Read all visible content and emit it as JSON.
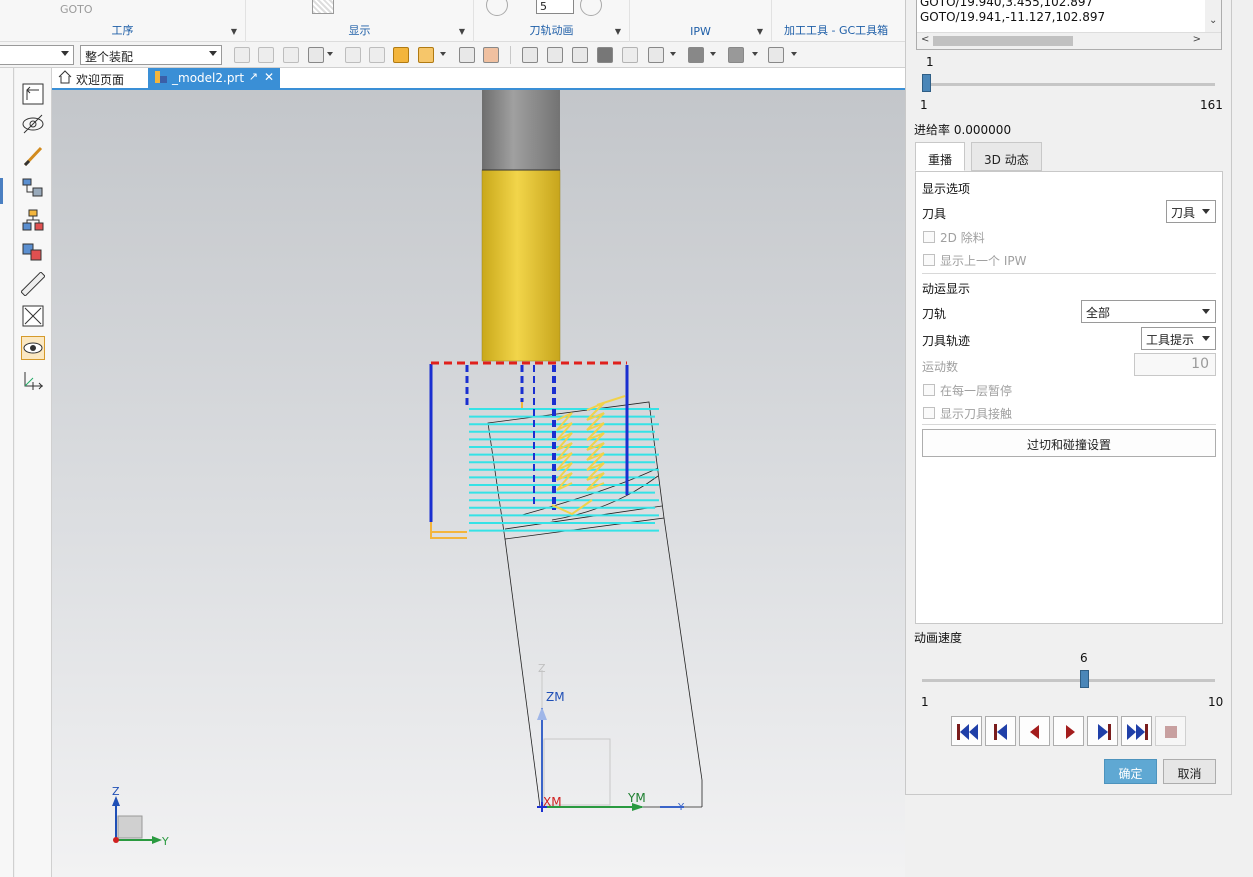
{
  "ribbon": {
    "ghost_text": "GOTO",
    "ghost_value": "5",
    "groups": [
      {
        "label": "工序"
      },
      {
        "label": "显示"
      },
      {
        "label": "刀轨动画"
      },
      {
        "label": "IPW"
      },
      {
        "label": "加工工具 - GC工具箱"
      }
    ]
  },
  "toolbar": {
    "filter_value": "",
    "assembly_value": "整个装配"
  },
  "tabs": [
    {
      "label": "欢迎页面",
      "icon": "home-icon"
    },
    {
      "label": "_model2.prt",
      "icon": "part-file-icon"
    }
  ],
  "viewport": {
    "csys_label_z": "Z",
    "csys_label_zm": "ZM",
    "csys_label_xm": "XM",
    "csys_label_ym": "YM",
    "csys_label_y": "Y",
    "triad_z": "Z",
    "triad_y": "Y",
    "colors": {
      "tool_holder": "#8c8c8c",
      "tool_body": "#e7c933",
      "rapid": "#e0201c",
      "engage": "#1a2fd0",
      "cut": "#35e2e6",
      "plunge": "#f1d24a"
    }
  },
  "dialog": {
    "goto_lines": [
      "GOTO/19.940,3.455,102.897",
      "GOTO/19.941,-11.127,102.897"
    ],
    "step_slider": {
      "current": "1",
      "min": "1",
      "max": "161",
      "fraction": 0.0
    },
    "feedrate": "进给率 0.000000",
    "tabs": [
      {
        "label": "重播"
      },
      {
        "label": "3D 动态"
      }
    ],
    "display_options_title": "显示选项",
    "tool_label": "刀具",
    "tool_value": "刀具",
    "remove_2d": "2D 除料",
    "show_prev_ipw": "显示上一个 IPW",
    "motion_display_title": "动运显示",
    "toolpath_label": "刀轨",
    "toolpath_value": "全部",
    "tool_trace_label": "刀具轨迹",
    "tool_trace_value": "工具提示",
    "motion_count_label": "运动数",
    "motion_count_value": "10",
    "pause_each_layer": "在每一层暂停",
    "show_tool_contact": "显示刀具接触",
    "gouge_button": "过切和碰撞设置",
    "anim_speed_label": "动画速度",
    "speed_slider": {
      "current": "6",
      "min": "1",
      "max": "10",
      "fraction": 0.5556
    },
    "ok": "确定",
    "cancel": "取消"
  }
}
